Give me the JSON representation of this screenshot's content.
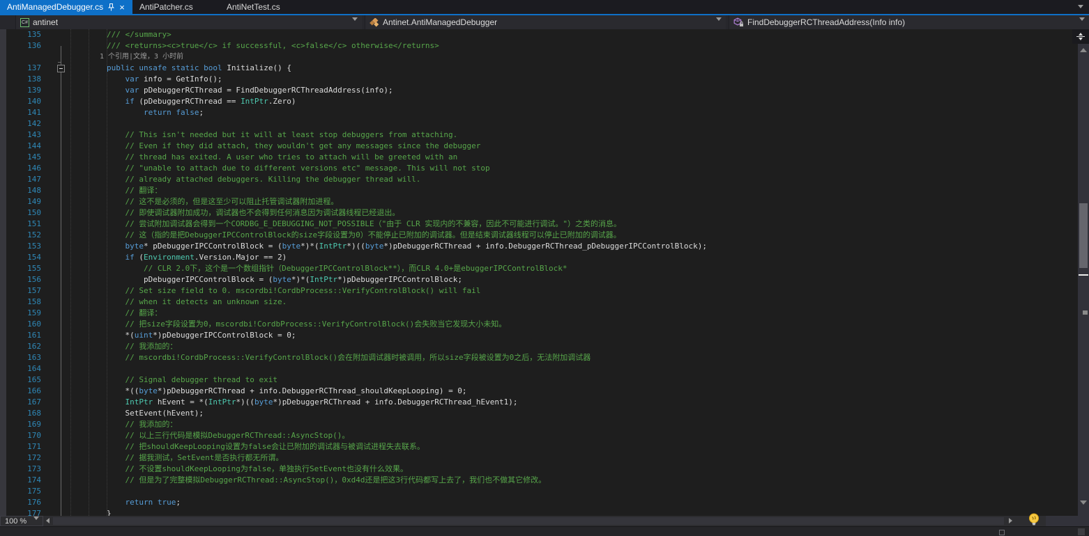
{
  "tabs": {
    "items": [
      {
        "label": "AntiManagedDebugger.cs",
        "active": true,
        "pinned": true,
        "closable": true
      },
      {
        "label": "AntiPatcher.cs",
        "active": false
      },
      {
        "label": "AntiNetTest.cs",
        "active": false
      }
    ]
  },
  "navbar": {
    "project": {
      "label": "antinet",
      "icon": "csharp-project-icon"
    },
    "type": {
      "label": "Antinet.AntiManagedDebugger",
      "icon": "class-icon"
    },
    "member": {
      "label": "FindDebuggerRCThreadAddress(Info info)",
      "icon": "method-private-icon"
    }
  },
  "zoom_control": {
    "label": "100 %"
  },
  "colors": {
    "accent_blue": "#0e70c8",
    "editor_bg": "#1e1e1e",
    "keyword": "#569cd6",
    "type": "#4ec9b0",
    "comment": "#57a64a",
    "plain": "#dcdcdc",
    "line_number": "#2f88b7",
    "codelens": "#9b9b9b",
    "lightbulb": "#f6c944"
  },
  "editor": {
    "lines": [
      {
        "n": "135",
        "s": [
          [
            "        /// </summary>",
            "c"
          ]
        ]
      },
      {
        "n": "136",
        "s": [
          [
            "        /// <returns><c>true</c> if successful, <c>false</c> otherwise</returns>",
            "c"
          ]
        ]
      },
      {
        "n": "",
        "lens": true,
        "s": [
          [
            "1 个引用|文煌，3 小时前",
            "lens"
          ]
        ]
      },
      {
        "n": "137",
        "fold": "collapse",
        "s": [
          [
            "        ",
            "p"
          ],
          [
            "public",
            "k"
          ],
          [
            " ",
            "p"
          ],
          [
            "unsafe",
            "k"
          ],
          [
            " ",
            "p"
          ],
          [
            "static",
            "k"
          ],
          [
            " ",
            "p"
          ],
          [
            "bool",
            "k"
          ],
          [
            " Initialize() {",
            "p"
          ]
        ]
      },
      {
        "n": "138",
        "s": [
          [
            "            ",
            "p"
          ],
          [
            "var",
            "k"
          ],
          [
            " info = GetInfo();",
            "p"
          ]
        ]
      },
      {
        "n": "139",
        "s": [
          [
            "            ",
            "p"
          ],
          [
            "var",
            "k"
          ],
          [
            " pDebuggerRCThread = FindDebuggerRCThreadAddress(info);",
            "p"
          ]
        ]
      },
      {
        "n": "140",
        "s": [
          [
            "            ",
            "p"
          ],
          [
            "if",
            "k"
          ],
          [
            " (pDebuggerRCThread == ",
            "p"
          ],
          [
            "IntPtr",
            "t"
          ],
          [
            ".Zero)",
            "p"
          ]
        ]
      },
      {
        "n": "141",
        "s": [
          [
            "                ",
            "p"
          ],
          [
            "return",
            "k"
          ],
          [
            " ",
            "p"
          ],
          [
            "false",
            "k"
          ],
          [
            ";",
            "p"
          ]
        ]
      },
      {
        "n": "142",
        "s": []
      },
      {
        "n": "143",
        "s": [
          [
            "            // This isn't needed but it will at least stop debuggers from attaching.",
            "c"
          ]
        ]
      },
      {
        "n": "144",
        "s": [
          [
            "            // Even if they did attach, they wouldn't get any messages since the debugger",
            "c"
          ]
        ]
      },
      {
        "n": "145",
        "s": [
          [
            "            // thread has exited. A user who tries to attach will be greeted with an",
            "c"
          ]
        ]
      },
      {
        "n": "146",
        "s": [
          [
            "            // \"unable to attach due to different versions etc\" message. This will not stop",
            "c"
          ]
        ]
      },
      {
        "n": "147",
        "s": [
          [
            "            // already attached debuggers. Killing the debugger thread will.",
            "c"
          ]
        ]
      },
      {
        "n": "148",
        "s": [
          [
            "            // 翻译：",
            "c"
          ]
        ]
      },
      {
        "n": "149",
        "s": [
          [
            "            // 这不是必须的，但是这至少可以阻止托管调试器附加进程。",
            "c"
          ]
        ]
      },
      {
        "n": "150",
        "s": [
          [
            "            // 即使调试器附加成功，调试器也不会得到任何消息因为调试器线程已经退出。",
            "c"
          ]
        ]
      },
      {
        "n": "151",
        "s": [
          [
            "            // 尝试附加调试器会得到一个CORDBG_E_DEBUGGING_NOT_POSSIBLE（\"由于 CLR 实现内的不兼容，因此不可能进行调试。\"）之类的消息。",
            "c"
          ]
        ]
      },
      {
        "n": "152",
        "s": [
          [
            "            // 这（指的是把DebuggerIPCControlBlock的size字段设置为0）不能停止已附加的调试器。但是结束调试器线程可以停止已附加的调试器。",
            "c"
          ]
        ]
      },
      {
        "n": "153",
        "s": [
          [
            "            ",
            "p"
          ],
          [
            "byte",
            "k"
          ],
          [
            "* pDebuggerIPCControlBlock = (",
            "p"
          ],
          [
            "byte",
            "k"
          ],
          [
            "*)*(",
            "p"
          ],
          [
            "IntPtr",
            "t"
          ],
          [
            "*)((",
            "p"
          ],
          [
            "byte",
            "k"
          ],
          [
            "*)pDebuggerRCThread + info.DebuggerRCThread_pDebuggerIPCControlBlock);",
            "p"
          ]
        ]
      },
      {
        "n": "154",
        "s": [
          [
            "            ",
            "p"
          ],
          [
            "if",
            "k"
          ],
          [
            " (",
            "p"
          ],
          [
            "Environment",
            "t"
          ],
          [
            ".Version.Major == 2)",
            "p"
          ]
        ]
      },
      {
        "n": "155",
        "s": [
          [
            "                // CLR 2.0下，这个是一个数组指针（DebuggerIPCControlBlock**），而CLR 4.0+是ebuggerIPCControlBlock*",
            "c"
          ]
        ]
      },
      {
        "n": "156",
        "s": [
          [
            "                pDebuggerIPCControlBlock = (",
            "p"
          ],
          [
            "byte",
            "k"
          ],
          [
            "*)*(",
            "p"
          ],
          [
            "IntPtr",
            "t"
          ],
          [
            "*)pDebuggerIPCControlBlock;",
            "p"
          ]
        ]
      },
      {
        "n": "157",
        "s": [
          [
            "            // Set size field to 0. mscordbi!CordbProcess::VerifyControlBlock() will fail",
            "c"
          ]
        ]
      },
      {
        "n": "158",
        "s": [
          [
            "            // when it detects an unknown size.",
            "c"
          ]
        ]
      },
      {
        "n": "159",
        "s": [
          [
            "            // 翻译：",
            "c"
          ]
        ]
      },
      {
        "n": "160",
        "s": [
          [
            "            // 把size字段设置为0，mscordbi!CordbProcess::VerifyControlBlock()会失败当它发现大小未知。",
            "c"
          ]
        ]
      },
      {
        "n": "161",
        "s": [
          [
            "            *(",
            "p"
          ],
          [
            "uint",
            "k"
          ],
          [
            "*)pDebuggerIPCControlBlock = 0;",
            "p"
          ]
        ]
      },
      {
        "n": "162",
        "s": [
          [
            "            // 我添加的：",
            "c"
          ]
        ]
      },
      {
        "n": "163",
        "s": [
          [
            "            // mscordbi!CordbProcess::VerifyControlBlock()会在附加调试器时被调用，所以size字段被设置为0之后，无法附加调试器",
            "c"
          ]
        ]
      },
      {
        "n": "164",
        "s": []
      },
      {
        "n": "165",
        "s": [
          [
            "            // Signal debugger thread to exit",
            "c"
          ]
        ]
      },
      {
        "n": "166",
        "s": [
          [
            "            *((",
            "p"
          ],
          [
            "byte",
            "k"
          ],
          [
            "*)pDebuggerRCThread + info.DebuggerRCThread_shouldKeepLooping) = 0;",
            "p"
          ]
        ]
      },
      {
        "n": "167",
        "s": [
          [
            "            ",
            "p"
          ],
          [
            "IntPtr",
            "t"
          ],
          [
            " hEvent = *(",
            "p"
          ],
          [
            "IntPtr",
            "t"
          ],
          [
            "*)((",
            "p"
          ],
          [
            "byte",
            "k"
          ],
          [
            "*)pDebuggerRCThread + info.DebuggerRCThread_hEvent1);",
            "p"
          ]
        ]
      },
      {
        "n": "168",
        "s": [
          [
            "            SetEvent(hEvent);",
            "p"
          ]
        ]
      },
      {
        "n": "169",
        "s": [
          [
            "            // 我添加的：",
            "c"
          ]
        ]
      },
      {
        "n": "170",
        "s": [
          [
            "            // 以上三行代码是模拟DebuggerRCThread::AsyncStop()。",
            "c"
          ]
        ]
      },
      {
        "n": "171",
        "s": [
          [
            "            // 把shouldKeepLooping设置为false会让已附加的调试器与被调试进程失去联系。",
            "c"
          ]
        ]
      },
      {
        "n": "172",
        "s": [
          [
            "            // 据我测试，SetEvent是否执行都无所谓。",
            "c"
          ]
        ]
      },
      {
        "n": "173",
        "s": [
          [
            "            // 不设置shouldKeepLooping为false，单独执行SetEvent也没有什么效果。",
            "c"
          ]
        ]
      },
      {
        "n": "174",
        "s": [
          [
            "            // 但是为了完整模拟DebuggerRCThread::AsyncStop()，0xd4d还是把这3行代码都写上去了，我们也不做其它修改。",
            "c"
          ]
        ]
      },
      {
        "n": "175",
        "s": []
      },
      {
        "n": "176",
        "s": [
          [
            "            ",
            "p"
          ],
          [
            "return",
            "k"
          ],
          [
            " ",
            "p"
          ],
          [
            "true",
            "k"
          ],
          [
            ";",
            "p"
          ]
        ]
      },
      {
        "n": "177",
        "s": [
          [
            "        }",
            "p"
          ]
        ]
      }
    ]
  }
}
